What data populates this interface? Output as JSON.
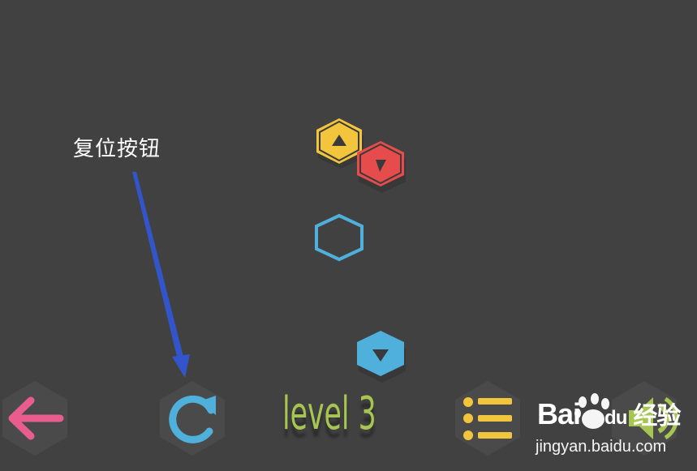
{
  "annotation": {
    "text": "复位按钮"
  },
  "level": {
    "label": "level 3"
  },
  "toolbar": {
    "back": {
      "icon": "arrow-left-icon",
      "color": "#e85d8e"
    },
    "reset": {
      "icon": "refresh-icon",
      "color": "#4fb0db"
    },
    "menu": {
      "icon": "list-icon",
      "color": "#f2c53d"
    },
    "sound": {
      "icon": "speaker-icon",
      "color": "#a6c651"
    }
  },
  "pieces": [
    {
      "type": "arrow-hex",
      "color": "#f2c53d",
      "direction": "up"
    },
    {
      "type": "arrow-hex",
      "color": "#e74c4c",
      "direction": "down-right"
    },
    {
      "type": "target-hex",
      "color": "#4fb0db"
    },
    {
      "type": "arrow-hex",
      "color": "#4fb0db",
      "direction": "down"
    }
  ],
  "watermark": {
    "logo": "Bai",
    "logo_suffix": "du",
    "logo_cn": "经验",
    "url": "jingyan.baidu.com"
  },
  "colors": {
    "background": "#414141",
    "button_bg": "#4a4a4a",
    "arrow_pointer": "#3355cc"
  }
}
